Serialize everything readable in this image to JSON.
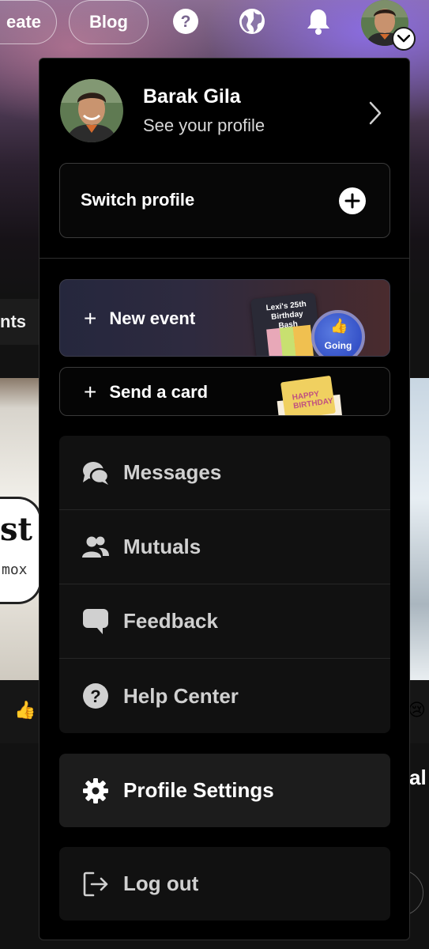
{
  "top_bar": {
    "create_label": "eate",
    "blog_label": "Blog",
    "icons": [
      "help-icon",
      "globe-icon",
      "bell-icon",
      "avatar",
      "chevron-down-icon"
    ]
  },
  "background": {
    "tab_label": "nts",
    "card_text": "st",
    "card_subtext": "mox",
    "right_text": "al"
  },
  "menu": {
    "profile": {
      "name": "Barak Gila",
      "subtitle": "See your profile"
    },
    "switch_profile_label": "Switch profile",
    "new_event": {
      "plus": "+",
      "label": "New event",
      "card_title": "Lexi's 25th Birthday Bash",
      "going_label": "Going"
    },
    "send_card": {
      "plus": "+",
      "label": "Send a card",
      "card_text": "HAPPY BIRTHDAY"
    },
    "items": [
      {
        "label": "Messages",
        "icon": "messages-icon"
      },
      {
        "label": "Mutuals",
        "icon": "mutuals-icon"
      },
      {
        "label": "Feedback",
        "icon": "feedback-icon"
      },
      {
        "label": "Help Center",
        "icon": "help-circle-icon"
      }
    ],
    "profile_settings_label": "Profile Settings",
    "log_out_label": "Log out"
  },
  "colors": {
    "menu_bg": "#000000",
    "item_bg": "#111111",
    "settings_bg": "#1c1c1c",
    "text_primary": "#ffffff",
    "text_item": "#d0d0d0"
  }
}
